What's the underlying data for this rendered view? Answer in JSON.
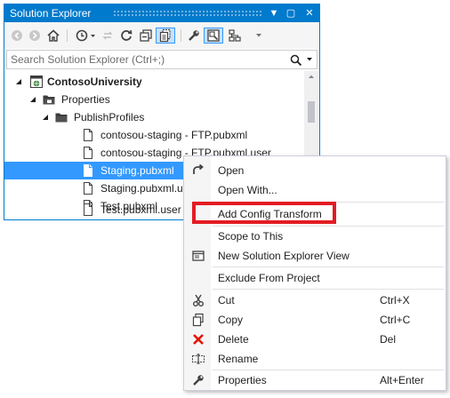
{
  "window": {
    "title": "Solution Explorer",
    "title_buttons": [
      "▼",
      "▢",
      "✕"
    ]
  },
  "toolbar": {
    "buttons": [
      "back-icon",
      "forward-icon",
      "home-icon",
      "history-icon",
      "sync-icon",
      "refresh-icon",
      "collapse-all-icon",
      "show-all-files-icon",
      "properties-icon",
      "preview-icon",
      "class-diagram-icon",
      "overflow-dropdown-icon"
    ]
  },
  "search": {
    "placeholder": "Search Solution Explorer (Ctrl+;)"
  },
  "tree": {
    "items": [
      {
        "label": "ContosoUniversity",
        "icon": "web-project-icon",
        "expanded": true
      },
      {
        "label": "Properties",
        "icon": "folder-icon",
        "expanded": true
      },
      {
        "label": "PublishProfiles",
        "icon": "folder-icon",
        "expanded": true
      },
      {
        "label": "contosou-staging - FTP.pubxml",
        "icon": "file-icon"
      },
      {
        "label": "contosou-staging - FTP.pubxml.user",
        "icon": "file-icon"
      },
      {
        "label": "Staging.pubxml",
        "icon": "file-icon",
        "selected": true
      },
      {
        "label": "Staging.pubxml.us",
        "icon": "file-icon"
      },
      {
        "label": "Test.pubxml",
        "icon": "file-icon"
      },
      {
        "label": "Test.pubxml.user",
        "icon": "file-icon"
      }
    ]
  },
  "context_menu": {
    "items": [
      {
        "label": "Open",
        "icon": "open-icon",
        "shortcut": ""
      },
      {
        "label": "Open With...",
        "icon": "",
        "shortcut": ""
      },
      {
        "label": "Add Config Transform",
        "icon": "",
        "shortcut": "",
        "highlighted": true
      },
      {
        "label": "Scope to This",
        "icon": "",
        "shortcut": ""
      },
      {
        "label": "New Solution Explorer View",
        "icon": "new-view-icon",
        "shortcut": ""
      },
      {
        "label": "Exclude From Project",
        "icon": "",
        "shortcut": ""
      },
      {
        "label": "Cut",
        "icon": "cut-icon",
        "shortcut": "Ctrl+X"
      },
      {
        "label": "Copy",
        "icon": "copy-icon",
        "shortcut": "Ctrl+C"
      },
      {
        "label": "Delete",
        "icon": "delete-icon",
        "shortcut": "Del"
      },
      {
        "label": "Rename",
        "icon": "rename-icon",
        "shortcut": ""
      },
      {
        "label": "Properties",
        "icon": "wrench-icon",
        "shortcut": "Alt+Enter"
      }
    ]
  },
  "colors": {
    "accent": "#007acc",
    "selection": "#3399ff",
    "highlight_box": "#e31b23",
    "delete_icon": "#e51400"
  }
}
